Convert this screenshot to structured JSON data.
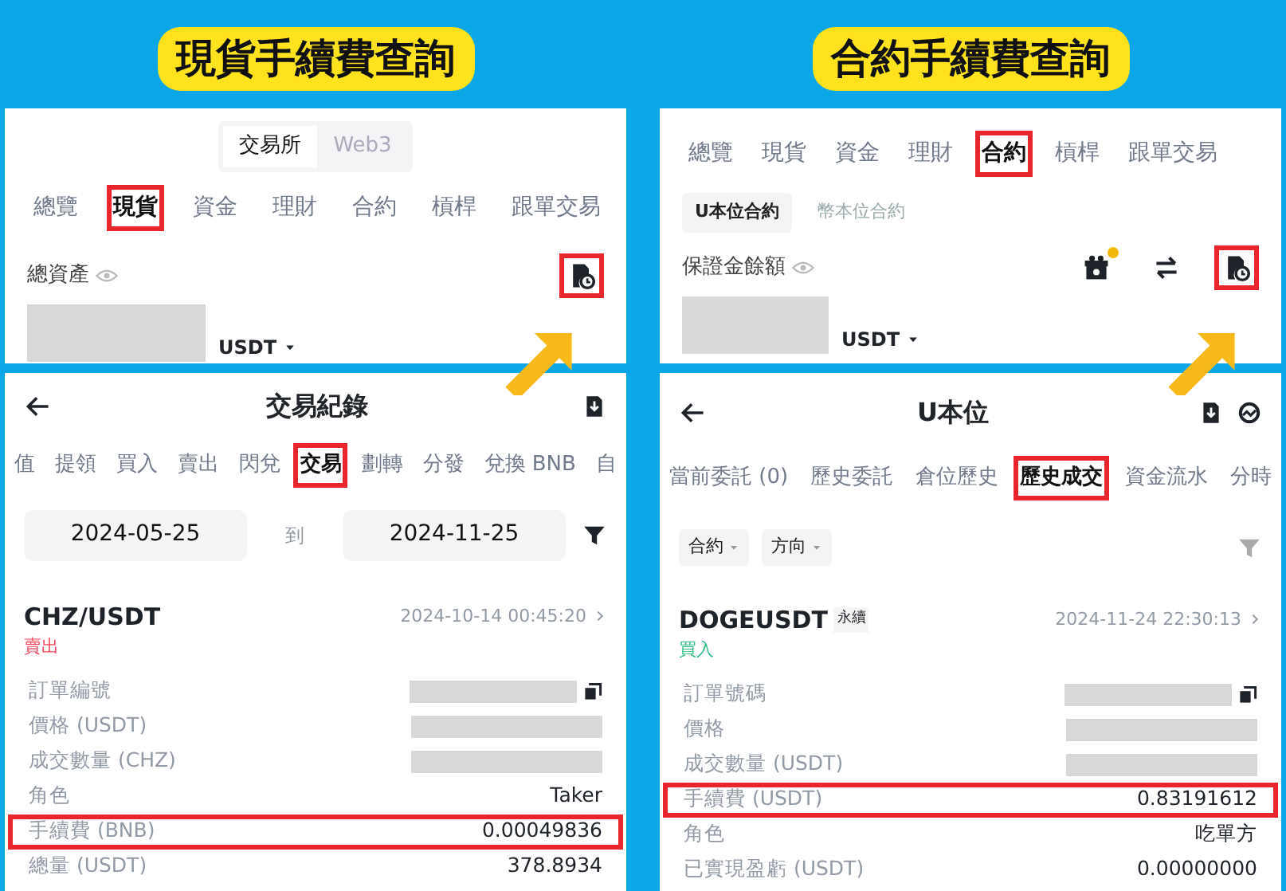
{
  "panels": [
    {
      "heading": "現貨手續費查詢",
      "account": {
        "switch": [
          {
            "label": "交易所",
            "selected": true
          },
          {
            "label": "Web3",
            "selected": false
          }
        ],
        "tabs": [
          {
            "label": "總覽",
            "selected": false,
            "highlighted": false
          },
          {
            "label": "現貨",
            "selected": true,
            "highlighted": true
          },
          {
            "label": "資金",
            "selected": false,
            "highlighted": false
          },
          {
            "label": "理財",
            "selected": false,
            "highlighted": false
          },
          {
            "label": "合約",
            "selected": false,
            "highlighted": false
          },
          {
            "label": "槓桿",
            "selected": false,
            "highlighted": false
          },
          {
            "label": "跟單交易",
            "selected": false,
            "highlighted": false
          }
        ],
        "balance_label": "總資產",
        "currency": "USDT",
        "actions": [
          {
            "kind": "history",
            "highlighted": true
          }
        ]
      },
      "records": {
        "title": "交易紀錄",
        "actions": [
          {
            "kind": "download"
          }
        ],
        "tabs": [
          {
            "label": "值",
            "selected": false,
            "highlighted": false
          },
          {
            "label": "提領",
            "selected": false,
            "highlighted": false
          },
          {
            "label": "買入",
            "selected": false,
            "highlighted": false
          },
          {
            "label": "賣出",
            "selected": false,
            "highlighted": false
          },
          {
            "label": "閃兌",
            "selected": false,
            "highlighted": false
          },
          {
            "label": "交易",
            "selected": true,
            "highlighted": true
          },
          {
            "label": "劃轉",
            "selected": false,
            "highlighted": false
          },
          {
            "label": "分發",
            "selected": false,
            "highlighted": false
          },
          {
            "label": "兌換 BNB",
            "selected": false,
            "highlighted": false
          },
          {
            "label": "自",
            "selected": false,
            "highlighted": false
          }
        ],
        "filters": {
          "kind": "dates",
          "from": "2024-05-25",
          "separator": "到",
          "to": "2024-11-25"
        },
        "trade": {
          "symbol": "CHZ/USDT",
          "time": "2024-10-14 00:45:20",
          "side": "賣出",
          "color": "#f6465d",
          "rows": [
            {
              "label": "訂單編號",
              "kind": "redacted",
              "copy": true,
              "highlighted": false
            },
            {
              "label": "價格 (USDT)",
              "kind": "redacted",
              "highlighted": false
            },
            {
              "label": "成交數量 (CHZ)",
              "kind": "redacted",
              "highlighted": false
            },
            {
              "label": "角色",
              "kind": "text",
              "value": "Taker",
              "highlighted": false
            },
            {
              "label": "手續費 (BNB)",
              "kind": "text",
              "value": "0.00049836",
              "highlighted": true
            },
            {
              "label": "總量 (USDT)",
              "kind": "text",
              "value": "378.8934",
              "highlighted": false
            }
          ]
        }
      }
    },
    {
      "heading": "合約手續費查詢",
      "account": {
        "tabs": [
          {
            "label": "總覽",
            "selected": false,
            "highlighted": false
          },
          {
            "label": "現貨",
            "selected": false,
            "highlighted": false
          },
          {
            "label": "資金",
            "selected": false,
            "highlighted": false
          },
          {
            "label": "理財",
            "selected": false,
            "highlighted": false
          },
          {
            "label": "合約",
            "selected": true,
            "highlighted": true
          },
          {
            "label": "槓桿",
            "selected": false,
            "highlighted": false
          },
          {
            "label": "跟單交易",
            "selected": false,
            "highlighted": false
          }
        ],
        "subtabs": [
          {
            "label": "U本位合約",
            "selected": true
          },
          {
            "label": "幣本位合約",
            "selected": false
          }
        ],
        "balance_label": "保證金餘額",
        "currency": "USDT",
        "actions": [
          {
            "kind": "gift",
            "badge": true,
            "highlighted": false
          },
          {
            "kind": "swap",
            "highlighted": false
          },
          {
            "kind": "history",
            "highlighted": true
          }
        ]
      },
      "records": {
        "title": "U本位",
        "actions": [
          {
            "kind": "download"
          },
          {
            "kind": "analysis"
          }
        ],
        "tabs": [
          {
            "label": "當前委託 (0)",
            "selected": false,
            "highlighted": false
          },
          {
            "label": "歷史委託",
            "selected": false,
            "highlighted": false
          },
          {
            "label": "倉位歷史",
            "selected": false,
            "highlighted": false
          },
          {
            "label": "歷史成交",
            "selected": true,
            "highlighted": true
          },
          {
            "label": "資金流水",
            "selected": false,
            "highlighted": false
          },
          {
            "label": "分時",
            "selected": false,
            "highlighted": false
          }
        ],
        "filters": {
          "kind": "dropdowns",
          "items": [
            "合約",
            "方向"
          ]
        },
        "trade": {
          "symbol": "DOGEUSDT",
          "tag": "永續",
          "time": "2024-11-24 22:30:13",
          "side": "買入",
          "color": "#2ebd85",
          "rows": [
            {
              "label": "訂單號碼",
              "kind": "redacted",
              "copy": true,
              "highlighted": false
            },
            {
              "label": "價格",
              "kind": "redacted",
              "highlighted": false
            },
            {
              "label": "成交數量 (USDT)",
              "kind": "redacted",
              "highlighted": false
            },
            {
              "label": "手續費 (USDT)",
              "kind": "text",
              "value": "0.83191612",
              "highlighted": true
            },
            {
              "label": "角色",
              "kind": "text",
              "value": "吃單方",
              "highlighted": false
            },
            {
              "label": "已實現盈虧 (USDT)",
              "kind": "text",
              "value": "0.00000000",
              "highlighted": false
            }
          ]
        }
      }
    }
  ]
}
